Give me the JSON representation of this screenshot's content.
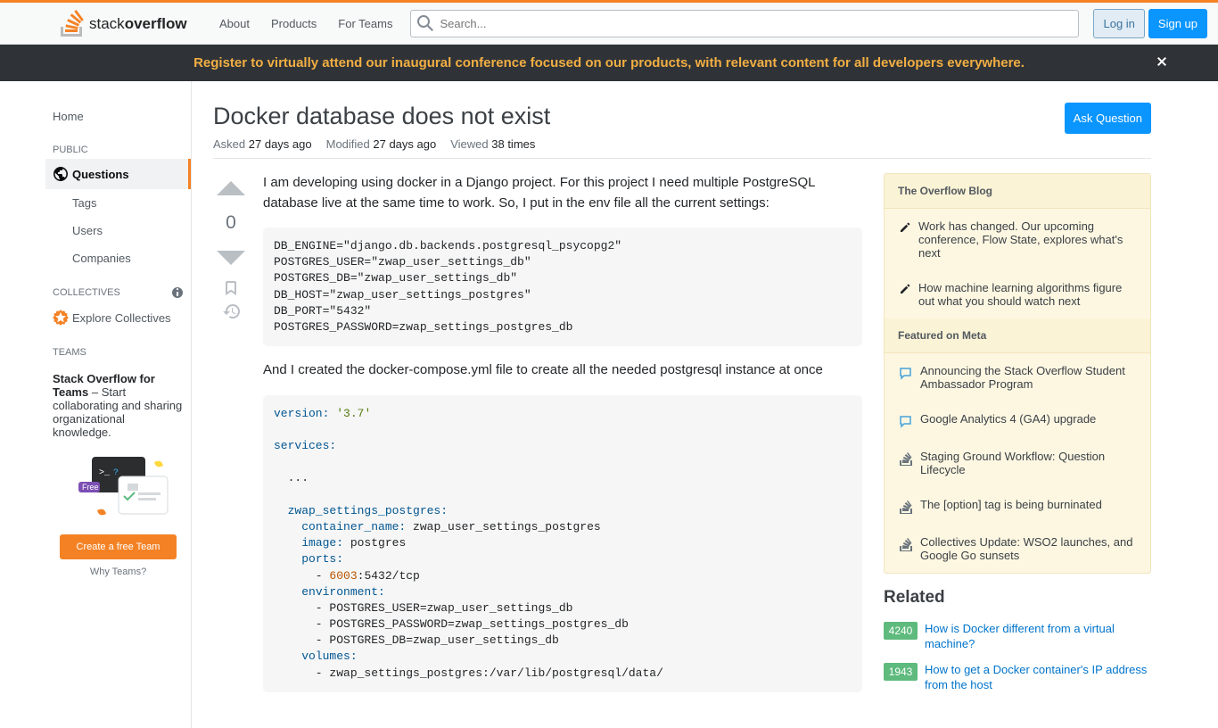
{
  "topnav": {
    "about": "About",
    "products": "Products",
    "for_teams": "For Teams",
    "search_placeholder": "Search...",
    "login": "Log in",
    "signup": "Sign up"
  },
  "banner": {
    "text": "Register to virtually attend our inaugural conference focused on our products, with relevant content for all developers everywhere."
  },
  "leftnav": {
    "home": "Home",
    "public": "PUBLIC",
    "questions": "Questions",
    "tags": "Tags",
    "users": "Users",
    "companies": "Companies",
    "collectives": "COLLECTIVES",
    "explore": "Explore Collectives",
    "teams": "TEAMS",
    "teams_promo_bold": "Stack Overflow for Teams",
    "teams_promo": " – Start collaborating and sharing organizational knowledge.",
    "create_team": "Create a free Team",
    "why_teams": "Why Teams?",
    "free_badge": "Free"
  },
  "question": {
    "title": "Docker database does not exist",
    "ask": "Ask Question",
    "asked_label": "Asked",
    "asked_value": "27 days ago",
    "modified_label": "Modified",
    "modified_value": "27 days ago",
    "viewed_label": "Viewed",
    "viewed_value": "38 times",
    "votes": "0",
    "body_p1": "I am developing using docker in a Django project. For this project I need multiple PostgreSQL database live at the same time to work. So, I put in the env file all the current settings:",
    "code1": "DB_ENGINE=\"django.db.backends.postgresql_psycopg2\"\nPOSTGRES_USER=\"zwap_user_settings_db\"\nPOSTGRES_DB=\"zwap_user_settings_db\"\nDB_HOST=\"zwap_user_settings_postgres\"\nDB_PORT=\"5432\"\nPOSTGRES_PASSWORD=zwap_settings_postgres_db",
    "body_p2": "And I created the docker-compose.yml file to create all the needed postgresql instance at once"
  },
  "sidebar": {
    "blog_header": "The Overflow Blog",
    "blog1": "Work has changed. Our upcoming conference, Flow State, explores what's next",
    "blog2": "How machine learning algorithms figure out what you should watch next",
    "meta_header": "Featured on Meta",
    "meta1": "Announcing the Stack Overflow Student Ambassador Program",
    "meta2": "Google Analytics 4 (GA4) upgrade",
    "meta3": "Staging Ground Workflow: Question Lifecycle",
    "meta4": "The [option] tag is being burninated",
    "meta5": "Collectives Update: WSO2 launches, and Google Go sunsets",
    "related_header": "Related",
    "related": [
      {
        "score": "4240",
        "title": "How is Docker different from a virtual machine?"
      },
      {
        "score": "1943",
        "title": "How to get a Docker container's IP address from the host"
      }
    ]
  }
}
